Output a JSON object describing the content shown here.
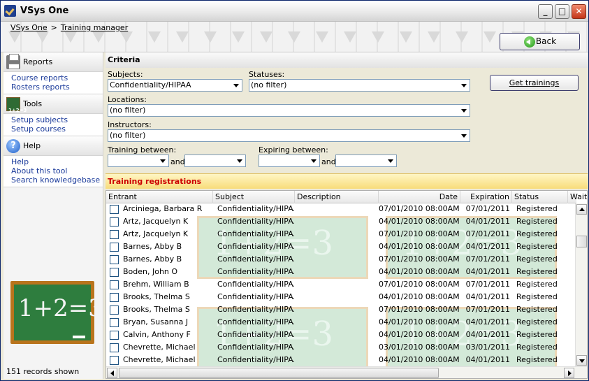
{
  "window": {
    "title": "VSys One"
  },
  "breadcrumb": {
    "home": "VSys One",
    "separator": ">",
    "current": "Training manager"
  },
  "back_button": {
    "label": "Back"
  },
  "sidebar": {
    "sections": [
      {
        "title": "Reports",
        "icon": "printer-icon",
        "links": [
          "Course reports",
          "Rosters reports"
        ]
      },
      {
        "title": "Tools",
        "icon": "chalkboard-icon",
        "links": [
          "Setup subjects",
          "Setup courses"
        ]
      },
      {
        "title": "Help",
        "icon": "help-icon",
        "links": [
          "Help",
          "About this tool",
          "Search knowledgebase"
        ]
      }
    ],
    "tools_icon_text": "1+2=3",
    "chalkboard_text": "1+2=3",
    "records_shown": "151 records shown"
  },
  "criteria": {
    "title": "Criteria",
    "subjects_label": "Subjects:",
    "subjects_value": "Confidentiality/HIPAA",
    "statuses_label": "Statuses:",
    "statuses_value": "(no filter)",
    "locations_label": "Locations:",
    "locations_value": "(no filter)",
    "instructors_label": "Instructors:",
    "instructors_value": "(no filter)",
    "training_between_label": "Training between:",
    "expiring_between_label": "Expiring between:",
    "and_label": "and",
    "get_trainings_label": "Get trainings"
  },
  "registrations": {
    "title": "Training registrations",
    "columns": [
      "Entrant",
      "Subject",
      "Description",
      "Date",
      "Expiration",
      "Status",
      "Wait"
    ],
    "rows": [
      {
        "entrant": "Arciniega, Barbara R",
        "subject": "Confidentiality/HIPAA",
        "description": "",
        "date": "07/01/2010 08:00AM",
        "expiration": "07/01/2011",
        "status": "Registered"
      },
      {
        "entrant": "Artz, Jacquelyn K",
        "subject": "Confidentiality/HIPAA",
        "description": "",
        "date": "04/01/2010 08:00AM",
        "expiration": "04/01/2011",
        "status": "Registered"
      },
      {
        "entrant": "Artz, Jacquelyn K",
        "subject": "Confidentiality/HIPAA",
        "description": "",
        "date": "07/01/2010 08:00AM",
        "expiration": "07/01/2011",
        "status": "Registered"
      },
      {
        "entrant": "Barnes, Abby B",
        "subject": "Confidentiality/HIPAA",
        "description": "",
        "date": "04/01/2010 08:00AM",
        "expiration": "04/01/2011",
        "status": "Registered"
      },
      {
        "entrant": "Barnes, Abby B",
        "subject": "Confidentiality/HIPAA",
        "description": "",
        "date": "07/01/2010 08:00AM",
        "expiration": "07/01/2011",
        "status": "Registered"
      },
      {
        "entrant": "Boden, John O",
        "subject": "Confidentiality/HIPAA",
        "description": "",
        "date": "04/01/2010 08:00AM",
        "expiration": "04/01/2011",
        "status": "Registered"
      },
      {
        "entrant": "Brehm, William B",
        "subject": "Confidentiality/HIPAA",
        "description": "",
        "date": "07/01/2010 08:00AM",
        "expiration": "07/01/2011",
        "status": "Registered"
      },
      {
        "entrant": "Brooks, Thelma S",
        "subject": "Confidentiality/HIPAA",
        "description": "",
        "date": "04/01/2010 08:00AM",
        "expiration": "04/01/2011",
        "status": "Registered"
      },
      {
        "entrant": "Brooks, Thelma S",
        "subject": "Confidentiality/HIPAA",
        "description": "",
        "date": "07/01/2010 08:00AM",
        "expiration": "07/01/2011",
        "status": "Registered"
      },
      {
        "entrant": "Bryan, Susanna J",
        "subject": "Confidentiality/HIPAA",
        "description": "",
        "date": "04/01/2010 08:00AM",
        "expiration": "04/01/2011",
        "status": "Registered"
      },
      {
        "entrant": "Calvin, Anthony F",
        "subject": "Confidentiality/HIPAA",
        "description": "",
        "date": "04/01/2010 08:00AM",
        "expiration": "04/01/2011",
        "status": "Registered"
      },
      {
        "entrant": "Chevrette, Michael",
        "subject": "Confidentiality/HIPAA",
        "description": "",
        "date": "03/01/2010 08:00AM",
        "expiration": "03/01/2011",
        "status": "Registered"
      },
      {
        "entrant": "Chevrette, Michael",
        "subject": "Confidentiality/HIPAA",
        "description": "",
        "date": "04/01/2010 08:00AM",
        "expiration": "04/01/2011",
        "status": "Registered"
      }
    ]
  }
}
